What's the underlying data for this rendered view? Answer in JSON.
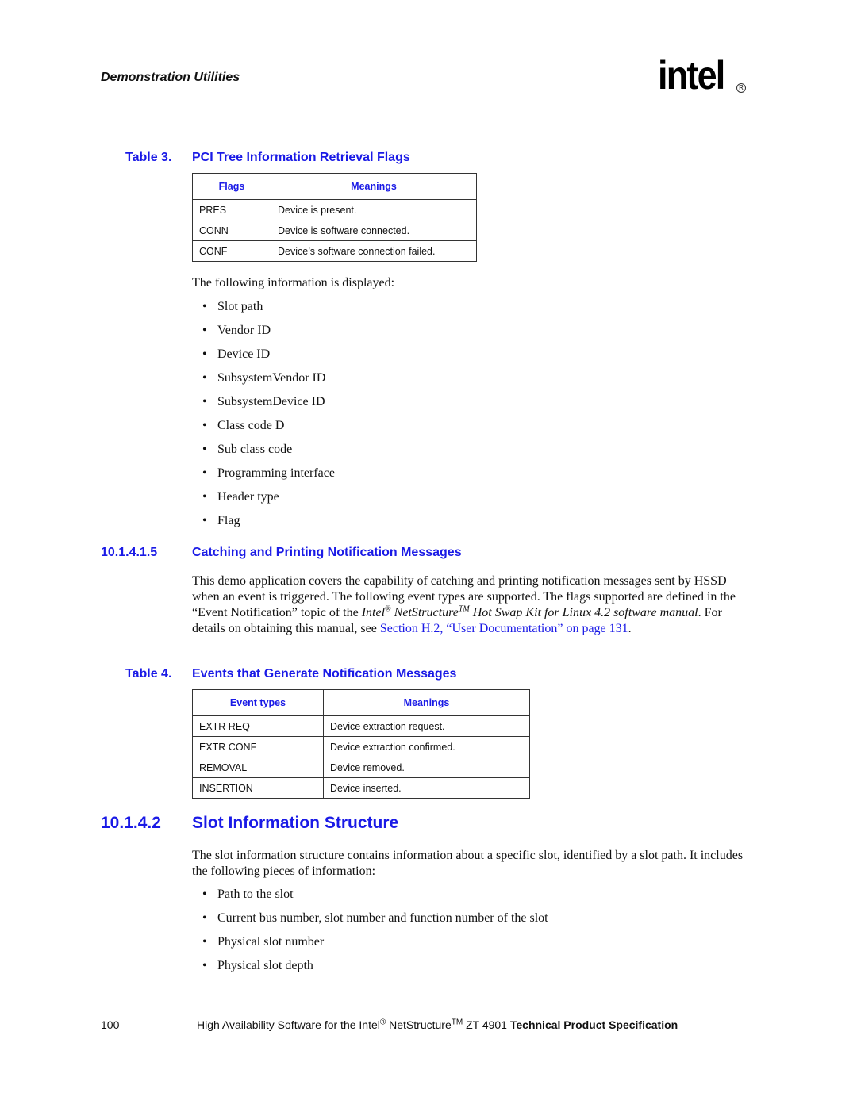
{
  "header": {
    "running_title": "Demonstration Utilities",
    "logo_text": "intel",
    "logo_registered": "R"
  },
  "table3": {
    "label": "Table 3.",
    "title": "PCI Tree Information Retrieval Flags",
    "columns": [
      "Flags",
      "Meanings"
    ],
    "rows": [
      [
        "PRES",
        "Device is present."
      ],
      [
        "CONN",
        "Device is software connected."
      ],
      [
        "CONF",
        "Device’s software connection failed."
      ]
    ]
  },
  "info_list": {
    "intro": "The following information is displayed:",
    "items": [
      "Slot path",
      "Vendor ID",
      "Device ID",
      "SubsystemVendor ID",
      "SubsystemDevice ID",
      "Class code D",
      "Sub class code",
      "Programming interface",
      "Header type",
      "Flag"
    ]
  },
  "section_10_1_4_1_5": {
    "number": "10.1.4.1.5",
    "title": "Catching and Printing Notification Messages",
    "para_part1": "This demo application covers the capability of catching and printing notification messages sent by HSSD when an event is triggered. The following event types are supported. The flags supported are defined in the “Event Notification” topic of the ",
    "italic_intel": "Intel",
    "italic_reg": "®",
    "italic_ns": " NetStructure",
    "italic_tm": "TM",
    "italic_rest": " Hot Swap Kit for Linux 4.2 software manual",
    "para_part2": ". For details on obtaining this manual, see ",
    "link_text": "Section H.2, “User Documentation” on page 131",
    "para_end": "."
  },
  "table4": {
    "label": "Table 4.",
    "title": "Events that Generate Notification Messages",
    "columns": [
      "Event types",
      "Meanings"
    ],
    "rows": [
      [
        "EXTR REQ",
        "Device extraction request."
      ],
      [
        "EXTR CONF",
        "Device extraction confirmed."
      ],
      [
        "REMOVAL",
        "Device removed."
      ],
      [
        "INSERTION",
        "Device inserted."
      ]
    ]
  },
  "section_10_1_4_2": {
    "number": "10.1.4.2",
    "title": "Slot Information Structure",
    "para": "The slot information structure contains information about a specific slot, identified by a slot path. It includes the following pieces of information:",
    "items": [
      "Path to the slot",
      "Current bus number, slot number and function number of the slot",
      "Physical slot number",
      "Physical slot depth"
    ]
  },
  "footer": {
    "page_number": "100",
    "text_part1": "High Availability Software for the Intel",
    "reg": "®",
    "text_part2": " NetStructure",
    "tm": "TM",
    "text_part3": " ZT 4901 ",
    "text_bold": "Technical Product Specification"
  }
}
